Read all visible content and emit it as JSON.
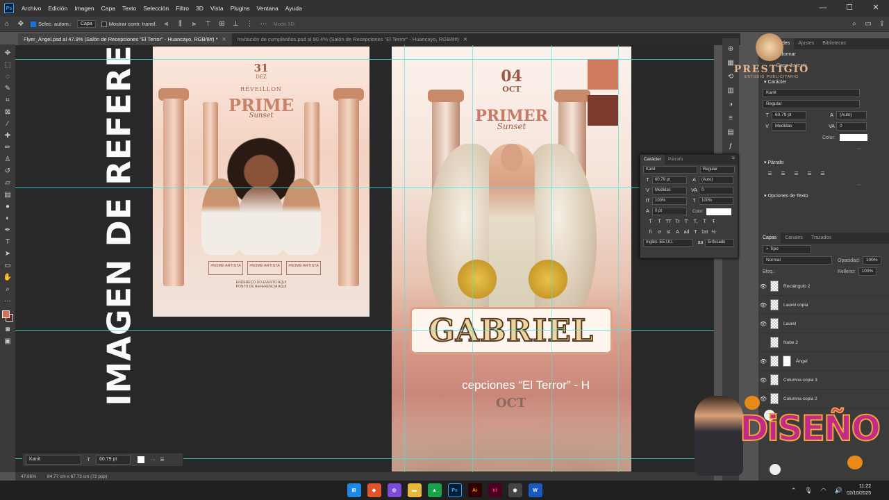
{
  "app": {
    "icon_label": "Ps"
  },
  "menu": [
    "Archivo",
    "Edición",
    "Imagen",
    "Capa",
    "Texto",
    "Selección",
    "Filtro",
    "3D",
    "Vista",
    "Plugins",
    "Ventana",
    "Ayuda"
  ],
  "window_controls": {
    "minimize": "—",
    "maximize": "☐",
    "close": "✕"
  },
  "options_bar": {
    "auto_select_label": "Selec. autom.:",
    "auto_select_target": "Capa",
    "show_transform_label": "Mostrar contr. transf.",
    "mode_3d_label": "Modo 3D:"
  },
  "tabs": [
    {
      "label": "Flyer_Ángel.psd al 47.9% (Salón de Recepciones \"El Terror\" - Huancayo, RGB/8#) *",
      "active": true
    },
    {
      "label": "Invitación de cumpleaños.psd al 90.4% (Salón de Recepciones \"El Terror\" - Huancayo, RGB/8#)",
      "active": false
    }
  ],
  "canvas": {
    "reference_label": "IMAGEN DE REFERENCIA",
    "reference_flyer": {
      "date": "31",
      "month": "DEZ",
      "kicker": "RÉVEILLON",
      "title": "PRIME",
      "subtitle": "Sunset",
      "artists": [
        "#NOME ARTISTA",
        "#NOME ARTISTA",
        "#NOME ARTISTA"
      ],
      "address": "ENDEREÇO DO EVENTO AQUI\nPONTO DE REFERENCIA AQUI"
    },
    "main_flyer": {
      "date": "04",
      "month": "OCT",
      "title": "PRIMER",
      "subtitle": "Sunset",
      "name": "GABRIEL",
      "venue_text": "cepciones “El Terror” - H",
      "oct_text": "OCT"
    },
    "swatches": [
      "#d07a5e",
      "#7a3a2e"
    ]
  },
  "floatbar": {
    "font": "Kanit",
    "size": "60.79 pt"
  },
  "status": {
    "zoom": "47.86%",
    "doc_size": "84.77 cm x 67.73 cm (72 ppp)"
  },
  "properties_panel": {
    "tabs": [
      "Propiedades",
      "Ajustes",
      "Bibliotecas"
    ],
    "transform_label": "Transformar",
    "layer_kind": "Capa de texto",
    "character_label": "Carácter",
    "font": "Kanit",
    "style": "Regular",
    "size": "60.79 pt",
    "leading": "(Auto)",
    "kerning": "Medidas",
    "tracking": "0",
    "color_label": "Color:",
    "paragraph_label": "Párrafo",
    "text_options_label": "Opciones de Texto"
  },
  "char_panel": {
    "tabs": [
      "Carácter",
      "Párrafo"
    ],
    "font": "Kanit",
    "style": "Regular",
    "size": "60.79 pt",
    "leading": "(Auto)",
    "kerning": "Medidas",
    "tracking": "0",
    "vscale": "100%",
    "hscale": "100%",
    "baseline": "0 pt",
    "color_label": "Color:",
    "glyphs": [
      "T",
      "T",
      "TT",
      "Tr",
      "T'",
      "T,",
      "T",
      "Ŧ"
    ],
    "glyphs2": [
      "fi",
      "ơ",
      "st",
      "A",
      "ad",
      "T",
      "1st",
      "½"
    ],
    "language": "Inglés: EE.UU.",
    "antialias": "Enfocado"
  },
  "layers_panel": {
    "tabs": [
      "Capas",
      "Canales",
      "Trazados"
    ],
    "filter": "Tipo",
    "blend": "Normal",
    "opacity_label": "Opacidad:",
    "opacity": "100%",
    "lock_label": "Bloq.:",
    "fill_label": "Relleno:",
    "fill": "100%",
    "layers": [
      {
        "name": "Rectángulo 2",
        "visible": true
      },
      {
        "name": "Laurel copia",
        "visible": true
      },
      {
        "name": "Laurel",
        "visible": true
      },
      {
        "name": "Nube 2",
        "visible": false
      },
      {
        "name": "Ángel",
        "visible": true
      },
      {
        "name": "Columna copia 3",
        "visible": true
      },
      {
        "name": "Columna copia 2",
        "visible": true
      }
    ]
  },
  "watermarks": {
    "top_brand": "PRESTIGIO",
    "top_sub": "ESTUDIO PUBLICITARIO",
    "bottom_brand": "DiSEÑO"
  },
  "taskbar": {
    "time": "11:22",
    "date": "02/10/2025"
  }
}
